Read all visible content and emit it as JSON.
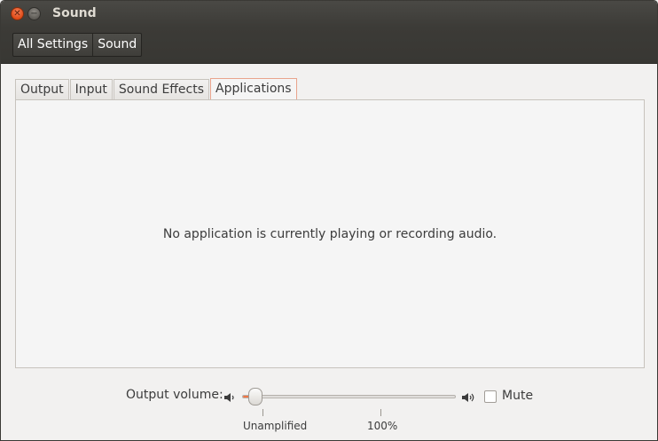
{
  "window": {
    "title": "Sound"
  },
  "breadcrumb": {
    "items": [
      "All Settings",
      "Sound"
    ]
  },
  "tabs": [
    {
      "label": "Output",
      "active": false
    },
    {
      "label": "Input",
      "active": false
    },
    {
      "label": "Sound Effects",
      "active": false
    },
    {
      "label": "Applications",
      "active": true
    }
  ],
  "panel": {
    "message": "No application is currently playing or recording audio."
  },
  "volume": {
    "label": "Output volume:",
    "level_fraction": 0.05,
    "ticks": [
      "Unamplified",
      "100%"
    ],
    "mute_label": "Mute",
    "muted": false
  },
  "colors": {
    "accent": "#f07746",
    "titlebar": "#3c3b37"
  }
}
